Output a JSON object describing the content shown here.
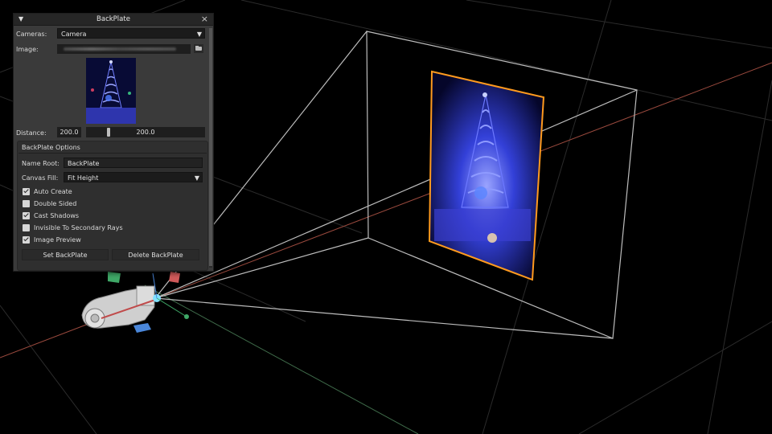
{
  "window": {
    "title": "BackPlate"
  },
  "fields": {
    "cameras_label": "Cameras:",
    "cameras_value": "Camera",
    "image_label": "Image:",
    "distance_label": "Distance:",
    "distance_value": "200.0",
    "distance_slider_value": "200.0",
    "distance_slider_fraction": 0.18
  },
  "options": {
    "title": "BackPlate Options",
    "name_root_label": "Name Root:",
    "name_root_value": "BackPlate",
    "canvas_fill_label": "Canvas Fill:",
    "canvas_fill_value": "Fit Height",
    "checkboxes": [
      {
        "label": "Auto Create",
        "checked": true
      },
      {
        "label": "Double Sided",
        "checked": false
      },
      {
        "label": "Cast Shadows",
        "checked": true
      },
      {
        "label": "Invisible To Secondary Rays",
        "checked": false
      },
      {
        "label": "Image Preview",
        "checked": true
      }
    ],
    "buttons": {
      "set": "Set BackPlate",
      "delete": "Delete BackPlate"
    }
  },
  "colors": {
    "panel": "#3a3a3a",
    "selection": "#ff9a1e",
    "wire": "#bdbdbd",
    "axis_x": "#9b4a3e",
    "axis_z": "#3f6b4a"
  },
  "icons": {
    "collapse": "triangle-down-icon",
    "close": "close-icon",
    "browse": "folder-icon",
    "dropdown": "dropdown-arrow-icon"
  }
}
